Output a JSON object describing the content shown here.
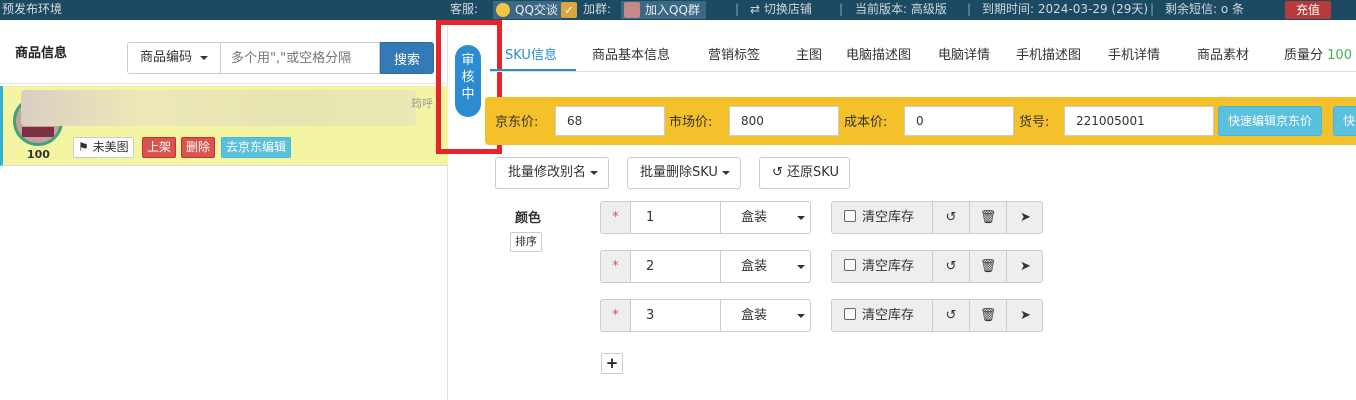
{
  "topbar": {
    "env": "预发布环境",
    "kf_label": "客服:",
    "qq_chat": "QQ交谈",
    "join_label": "加群:",
    "join_qq_group": "加入QQ群",
    "sep": "|",
    "switch_store": "⇄ 切换店铺",
    "version": "当前版本: 高级版",
    "expiry": "到期时间: 2024-03-29 (29天)",
    "sms_left": "剩余短信: o 条",
    "recharge": "充值",
    "check_mark": "✓"
  },
  "left_panel": {
    "title": "商品信息",
    "search_select": "商品编码",
    "search_placeholder": "多个用\",\"或空格分隔",
    "search_button": "搜索",
    "product": {
      "score": "100",
      "title_tail": "筠呼",
      "btn_no_pic": "未美图",
      "btn_list": "上架",
      "btn_delete": "删除",
      "btn_jd_edit": "去京东编辑"
    }
  },
  "review_status": [
    "审",
    "核",
    "中"
  ],
  "tabs": [
    {
      "label": "SKU信息",
      "active": true
    },
    {
      "label": "商品基本信息"
    },
    {
      "label": "营销标签"
    },
    {
      "label": "主图"
    },
    {
      "label": "电脑描述图"
    },
    {
      "label": "电脑详情"
    },
    {
      "label": "手机描述图"
    },
    {
      "label": "手机详情"
    },
    {
      "label": "商品素材"
    },
    {
      "label": "质量分",
      "score": "100"
    }
  ],
  "price_bar": {
    "jd_price_label": "京东价:",
    "jd_price": "68",
    "market_price_label": "市场价:",
    "market_price": "800",
    "cost_price_label": "成本价:",
    "cost_price": "0",
    "item_no_label": "货号:",
    "item_no": "221005001",
    "quick_edit_jd_price": "快速编辑京东价",
    "quick_edit_more": "快"
  },
  "actions": {
    "batch_rename": "批量修改别名",
    "batch_delete_sku": "批量删除SKU",
    "restore_sku": "还原SKU"
  },
  "sku": {
    "attr_label": "颜色",
    "sort_btn": "排序",
    "required_mark": "*",
    "clear_stock": "清空库存",
    "rows": [
      {
        "value": "1",
        "unit": "盒装"
      },
      {
        "value": "2",
        "unit": "盒装"
      },
      {
        "value": "3",
        "unit": "盒装"
      }
    ],
    "add_button": "+"
  }
}
